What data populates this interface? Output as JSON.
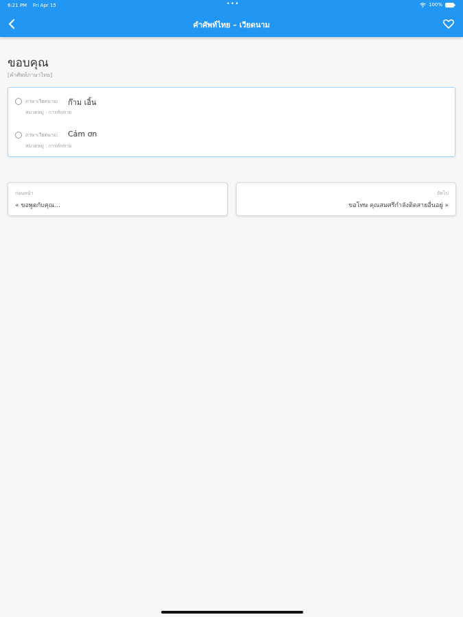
{
  "status_bar": {
    "time": "6:21 PM",
    "date": "Fri Apr 15",
    "dots": "•••",
    "battery": "100%"
  },
  "header": {
    "title": "คำศัพท์ไทย – เวียดนาม"
  },
  "word": {
    "title": "ขอบคุณ",
    "subtitle": "[คำศัพท์ภาษาไทย]"
  },
  "translations": [
    {
      "lang_label": "ภาษาเวียดนาม:",
      "text": "ก๊าม เอิ้น",
      "category": "หมวดหมู่ : การทักทาย"
    },
    {
      "lang_label": "ภาษาเวียดนาม:",
      "text": "Cảm ơn",
      "category": "หมวดหมู่ : การทักทาย"
    }
  ],
  "navigation": {
    "previous": {
      "caption": "ก่อนหน้า",
      "word": "« ขอพูดกับคุณ..."
    },
    "next": {
      "caption": "ถัดไป",
      "word": "ขอโทษ คุณสมศรีกำลังติดสายอื่นอยู่ »"
    }
  },
  "colors": {
    "primary": "#2196f3",
    "background": "#f7f7f7",
    "card_border": "#a9d3f5"
  }
}
